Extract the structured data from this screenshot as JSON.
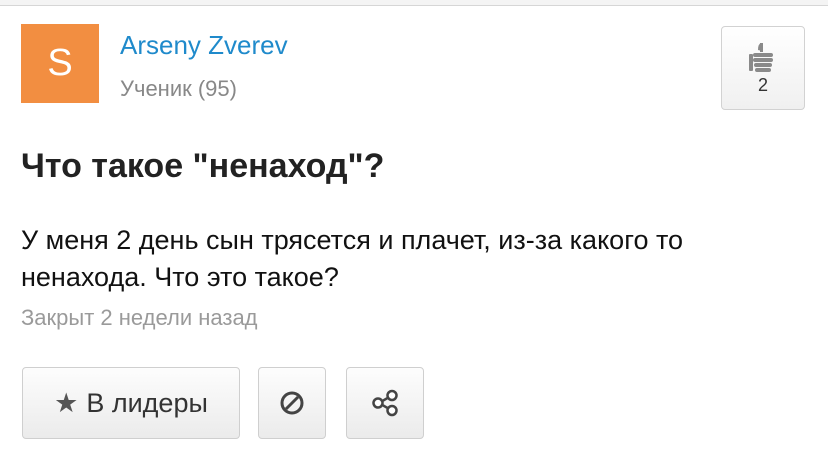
{
  "author": {
    "avatar_letter": "S",
    "avatar_color": "#f28e41",
    "name": "Arseny Zverev",
    "rank": "Ученик (95)"
  },
  "like": {
    "icon": "thumbs-up-icon",
    "count": "2"
  },
  "question": {
    "title": "Что такое \"ненаход\"?",
    "body": "У меня 2 день сын трясется и плачет, из-за какого то ненахода. Что это такое?",
    "status": "Закрыт 2 недели назад"
  },
  "actions": {
    "leaders_label": "В лидеры",
    "leaders_icon": "star-icon",
    "report_icon": "block-icon",
    "share_icon": "share-icon"
  },
  "colors": {
    "link": "#1f8acb",
    "muted": "#888888"
  }
}
